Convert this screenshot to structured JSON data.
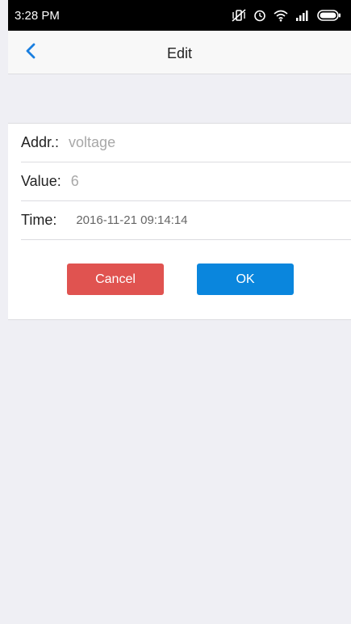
{
  "status_bar": {
    "time": "3:28 PM",
    "icons": [
      "vibrate-off-icon",
      "alarm-icon",
      "wifi-icon",
      "signal-icon",
      "battery-icon"
    ]
  },
  "nav": {
    "back_icon": "chevron-left-icon",
    "title": "Edit",
    "accent_color": "#1a7fe0"
  },
  "form": {
    "addr": {
      "label": "Addr.:",
      "value": "voltage"
    },
    "value": {
      "label": "Value:",
      "value": "6"
    },
    "time": {
      "label": "Time:",
      "value": "2016-11-21 09:14:14"
    }
  },
  "buttons": {
    "cancel": {
      "label": "Cancel",
      "color": "#e05350"
    },
    "ok": {
      "label": "OK",
      "color": "#0a86dd"
    }
  }
}
